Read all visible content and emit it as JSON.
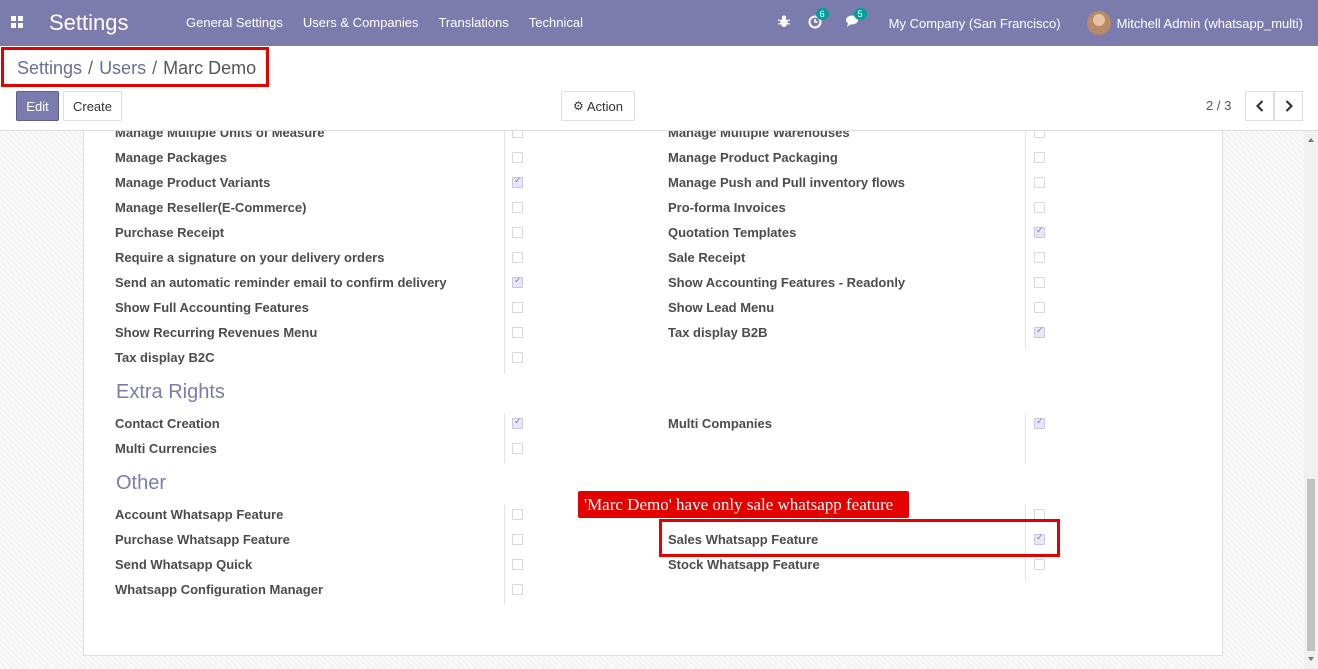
{
  "navbar": {
    "app_title": "Settings",
    "menu": [
      "General Settings",
      "Users & Companies",
      "Translations",
      "Technical"
    ],
    "activity_count": "6",
    "message_count": "5",
    "company": "My Company (San Francisco)",
    "user": "Mitchell Admin (whatsapp_multi)"
  },
  "breadcrumb": {
    "settings": "Settings",
    "users": "Users",
    "current": "Marc Demo",
    "sep": "/"
  },
  "toolbar": {
    "edit": "Edit",
    "create": "Create",
    "action": "Action",
    "pager": "2 / 3"
  },
  "icons": {
    "apps": "apps-grid-icon",
    "bug": "bug-icon",
    "activity": "clock-icon",
    "messages": "chat-icon",
    "gear": "gear-icon",
    "prev": "chevron-left-icon",
    "next": "chevron-right-icon"
  },
  "rights": {
    "left": [
      {
        "label": "Manage Multiple Units of Measure",
        "checked": false
      },
      {
        "label": "Manage Packages",
        "checked": false
      },
      {
        "label": "Manage Product Variants",
        "checked": true
      },
      {
        "label": "Manage Reseller(E-Commerce)",
        "checked": false
      },
      {
        "label": "Purchase Receipt",
        "checked": false
      },
      {
        "label": "Require a signature on your delivery orders",
        "checked": false
      },
      {
        "label": "Send an automatic reminder email to confirm delivery",
        "checked": true
      },
      {
        "label": "Show Full Accounting Features",
        "checked": false
      },
      {
        "label": "Show Recurring Revenues Menu",
        "checked": false
      },
      {
        "label": "Tax display B2C",
        "checked": false
      }
    ],
    "right": [
      {
        "label": "Manage Multiple Warehouses",
        "checked": false
      },
      {
        "label": "Manage Product Packaging",
        "checked": false
      },
      {
        "label": "Manage Push and Pull inventory flows",
        "checked": false
      },
      {
        "label": "Pro-forma Invoices",
        "checked": false
      },
      {
        "label": "Quotation Templates",
        "checked": true
      },
      {
        "label": "Sale Receipt",
        "checked": false
      },
      {
        "label": "Show Accounting Features - Readonly",
        "checked": false
      },
      {
        "label": "Show Lead Menu",
        "checked": false
      },
      {
        "label": "Tax display B2B",
        "checked": true
      }
    ]
  },
  "extra_rights": {
    "title": "Extra Rights",
    "left": [
      {
        "label": "Contact Creation",
        "checked": true
      },
      {
        "label": "Multi Currencies",
        "checked": false
      }
    ],
    "right": [
      {
        "label": "Multi Companies",
        "checked": true
      }
    ]
  },
  "other": {
    "title": "Other",
    "left": [
      {
        "label": "Account Whatsapp Feature",
        "checked": false
      },
      {
        "label": "Purchase Whatsapp Feature",
        "checked": false
      },
      {
        "label": "Send Whatsapp Quick",
        "checked": false
      },
      {
        "label": "Whatsapp Configuration Manager",
        "checked": false
      }
    ],
    "right": [
      {
        "label": "",
        "checked": false
      },
      {
        "label": "Sales Whatsapp Feature",
        "checked": true
      },
      {
        "label": "Stock Whatsapp Feature",
        "checked": false
      }
    ]
  },
  "annotation": {
    "callout": "'Marc Demo' have only sale whatsapp feature"
  },
  "colors": {
    "brand": "#7c7bad",
    "highlight": "#e50000"
  }
}
